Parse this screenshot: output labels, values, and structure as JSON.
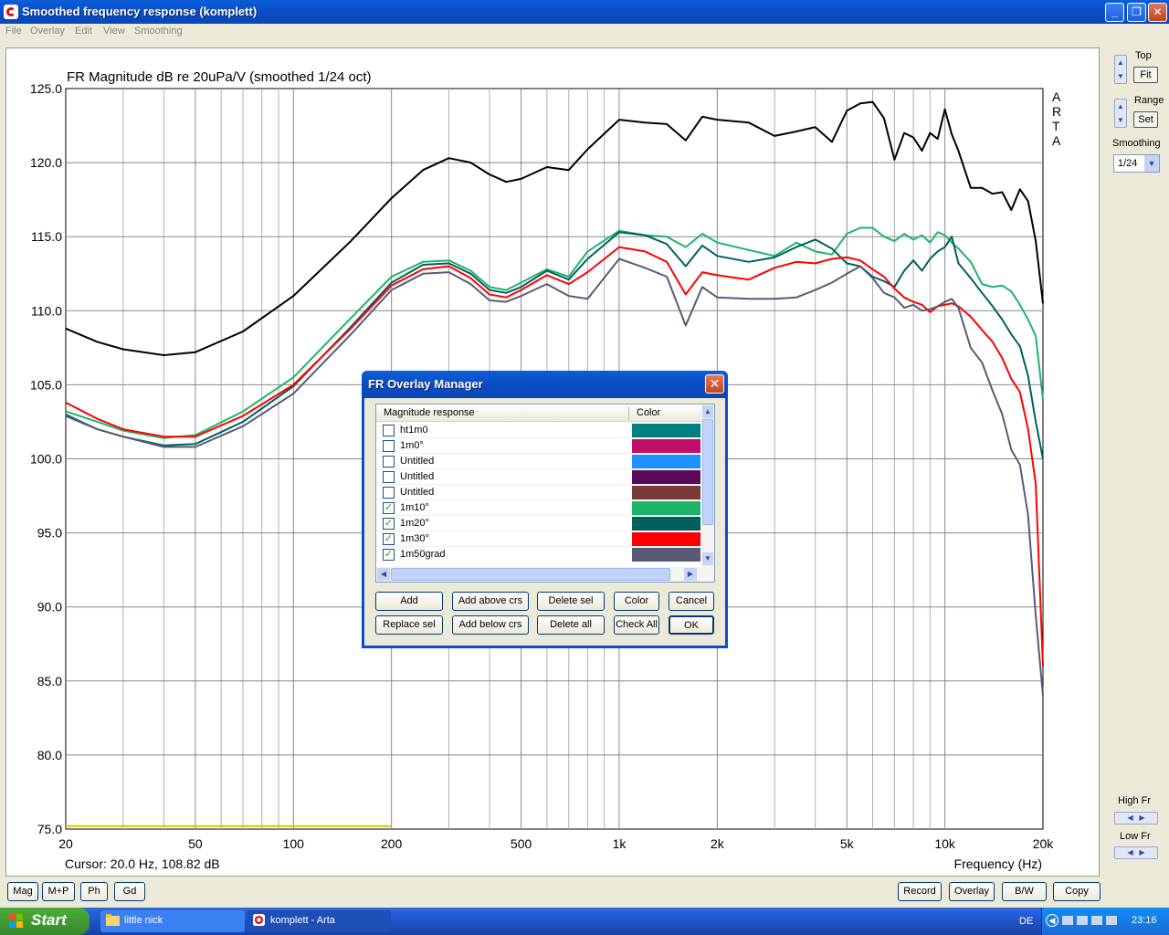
{
  "window": {
    "title": "Smoothed frequency response (komplett)"
  },
  "menu": [
    "File",
    "Overlay",
    "Edit",
    "View",
    "Smoothing"
  ],
  "plot": {
    "title": "FR Magnitude dB re 20uPa/V (smoothed 1/24 oct)",
    "watermark": [
      "A",
      "R",
      "T",
      "A"
    ],
    "cursor": "Cursor: 20.0 Hz, 108.82 dB",
    "xlabel": "Frequency (Hz)"
  },
  "side": {
    "top_label": "Top",
    "fit_label": "Fit",
    "range_label": "Range",
    "set_label": "Set",
    "smoothing_label": "Smoothing",
    "smoothing_value": "1/24",
    "highfr_label": "High Fr",
    "lowfr_label": "Low Fr"
  },
  "bottom_left": [
    "Mag",
    "M+P",
    "Ph",
    "Gd"
  ],
  "bottom_right": [
    "Record",
    "Overlay",
    "B/W",
    "Copy"
  ],
  "dialog": {
    "title": "FR Overlay Manager",
    "col_name": "Magnitude response",
    "col_color": "Color",
    "rows": [
      {
        "name": "ht1m0",
        "checked": false,
        "color": "#008080"
      },
      {
        "name": "1m0°",
        "checked": false,
        "color": "#c0106a"
      },
      {
        "name": "Untitled",
        "checked": false,
        "color": "#1e90ff"
      },
      {
        "name": "Untitled",
        "checked": false,
        "color": "#5a0a5a"
      },
      {
        "name": "Untitled",
        "checked": false,
        "color": "#7a3a3a"
      },
      {
        "name": "1m10°",
        "checked": true,
        "color": "#1db46a"
      },
      {
        "name": "1m20°",
        "checked": true,
        "color": "#006060"
      },
      {
        "name": "1m30°",
        "checked": true,
        "color": "#ff0000"
      },
      {
        "name": "1m50grad",
        "checked": true,
        "color": "#5a5a78"
      }
    ],
    "buttons_row1": [
      "Add",
      "Add above crs",
      "Delete sel",
      "Color",
      "Cancel"
    ],
    "buttons_row2": [
      "Replace sel",
      "Add below crs",
      "Delete all",
      "Check All",
      "OK"
    ]
  },
  "taskbar": {
    "start": "Start",
    "tasks": [
      "little nick",
      "komplett - Arta"
    ],
    "lang": "DE",
    "time": "23:16"
  },
  "chart_data": {
    "type": "line",
    "title": "FR Magnitude dB re 20uPa/V (smoothed 1/24 oct)",
    "xlabel": "Frequency (Hz)",
    "ylabel": "",
    "xscale": "log",
    "xlim": [
      20,
      20000
    ],
    "ylim": [
      75,
      125
    ],
    "xticks": [
      20,
      50,
      100,
      200,
      500,
      1000,
      2000,
      5000,
      10000,
      20000
    ],
    "xtick_labels": [
      "20",
      "50",
      "100",
      "200",
      "500",
      "1k",
      "2k",
      "5k",
      "10k",
      "20k"
    ],
    "yticks": [
      75,
      80,
      85,
      90,
      95,
      100,
      105,
      110,
      115,
      120,
      125
    ],
    "ytick_labels": [
      "75.0",
      "80.0",
      "85.0",
      "90.0",
      "95.0",
      "100.0",
      "105.0",
      "110.0",
      "115.0",
      "120.0",
      "125.0"
    ],
    "grid": true,
    "series": [
      {
        "color": "#000000",
        "x": [
          20,
          25,
          30,
          40,
          50,
          70,
          100,
          150,
          200,
          250,
          300,
          350,
          400,
          450,
          500,
          600,
          700,
          800,
          1000,
          1200,
          1400,
          1600,
          1800,
          2000,
          2500,
          3000,
          3500,
          4000,
          4500,
          5000,
          5500,
          6000,
          6500,
          7000,
          7500,
          8000,
          8500,
          9000,
          9500,
          10000,
          10500,
          11000,
          12000,
          13000,
          14000,
          15000,
          16000,
          17000,
          18000,
          19000,
          20000
        ],
        "y": [
          108.8,
          107.9,
          107.4,
          107.0,
          107.2,
          108.6,
          111.0,
          114.7,
          117.6,
          119.5,
          120.3,
          120.0,
          119.2,
          118.7,
          118.9,
          119.7,
          119.5,
          120.9,
          122.9,
          122.7,
          122.6,
          121.5,
          123.1,
          122.9,
          122.7,
          121.8,
          122.1,
          122.4,
          121.4,
          123.5,
          124.0,
          124.1,
          123.0,
          120.2,
          122.0,
          121.7,
          120.8,
          122.0,
          121.6,
          123.6,
          121.9,
          120.8,
          118.3,
          118.3,
          117.9,
          118.0,
          116.8,
          118.2,
          117.4,
          114.7,
          110.5
        ]
      },
      {
        "color": "#1db46a",
        "x": [
          20,
          25,
          30,
          40,
          50,
          70,
          100,
          150,
          200,
          250,
          300,
          350,
          400,
          450,
          500,
          600,
          700,
          800,
          1000,
          1200,
          1400,
          1600,
          1800,
          2000,
          2500,
          3000,
          3500,
          4000,
          4500,
          5000,
          5500,
          6000,
          6500,
          7000,
          7500,
          8000,
          8500,
          9000,
          9500,
          10000,
          10500,
          11000,
          12000,
          13000,
          14000,
          15000,
          16000,
          17000,
          18000,
          19000,
          20000
        ],
        "y": [
          103.2,
          102.5,
          101.9,
          101.4,
          101.6,
          103.2,
          105.5,
          109.5,
          112.3,
          113.3,
          113.4,
          112.7,
          111.6,
          111.4,
          111.9,
          112.8,
          112.3,
          114.0,
          115.4,
          115.1,
          115.0,
          114.3,
          115.2,
          114.6,
          114.1,
          113.7,
          114.6,
          114.0,
          113.8,
          115.2,
          115.6,
          115.6,
          115.0,
          114.7,
          115.2,
          114.8,
          115.1,
          114.6,
          115.3,
          115.1,
          114.6,
          114.2,
          113.3,
          111.8,
          111.6,
          111.7,
          111.3,
          110.4,
          109.4,
          108.3,
          104.0
        ]
      },
      {
        "color": "#006060",
        "x": [
          20,
          25,
          30,
          40,
          50,
          70,
          100,
          150,
          200,
          250,
          300,
          350,
          400,
          450,
          500,
          600,
          700,
          800,
          1000,
          1200,
          1400,
          1600,
          1800,
          2000,
          2500,
          3000,
          3500,
          4000,
          4500,
          5000,
          5500,
          6000,
          6500,
          7000,
          7500,
          8000,
          8500,
          9000,
          9500,
          10000,
          10500,
          11000,
          12000,
          13000,
          14000,
          15000,
          16000,
          17000,
          18000,
          19000,
          20000
        ],
        "y": [
          102.9,
          102.0,
          101.5,
          100.9,
          101.0,
          102.5,
          104.9,
          108.9,
          111.9,
          113.1,
          113.2,
          112.5,
          111.4,
          111.2,
          111.6,
          112.7,
          112.1,
          113.5,
          115.3,
          115.1,
          114.5,
          113.0,
          114.4,
          113.7,
          113.3,
          113.6,
          114.3,
          114.8,
          114.2,
          113.2,
          113.0,
          112.3,
          112.0,
          111.6,
          112.7,
          113.4,
          112.7,
          113.5,
          114.0,
          114.3,
          115.0,
          113.2,
          112.2,
          111.2,
          110.3,
          109.4,
          108.4,
          107.6,
          105.6,
          102.5,
          100.0
        ]
      },
      {
        "color": "#ff0000",
        "x": [
          20,
          25,
          30,
          40,
          50,
          70,
          100,
          150,
          200,
          250,
          300,
          350,
          400,
          450,
          500,
          600,
          700,
          800,
          1000,
          1200,
          1400,
          1600,
          1800,
          2000,
          2500,
          3000,
          3500,
          4000,
          4500,
          5000,
          5500,
          6000,
          6500,
          7000,
          7500,
          8000,
          8500,
          9000,
          9500,
          10000,
          10500,
          11000,
          12000,
          13000,
          14000,
          15000,
          16000,
          17000,
          18000,
          19000,
          20000
        ],
        "y": [
          103.8,
          102.7,
          102.0,
          101.5,
          101.5,
          102.9,
          105.0,
          108.8,
          111.7,
          112.8,
          113.0,
          112.2,
          111.1,
          110.9,
          111.4,
          112.4,
          111.8,
          112.6,
          114.3,
          114.0,
          113.3,
          111.1,
          112.6,
          112.4,
          112.1,
          112.9,
          113.3,
          113.2,
          113.5,
          113.6,
          113.4,
          112.8,
          112.3,
          111.5,
          110.9,
          110.6,
          110.4,
          109.9,
          110.3,
          110.4,
          110.5,
          110.3,
          109.6,
          108.7,
          107.9,
          106.8,
          105.4,
          104.5,
          102.0,
          98.3,
          86.0
        ]
      },
      {
        "color": "#5a5a78",
        "x": [
          20,
          25,
          30,
          40,
          50,
          70,
          100,
          150,
          200,
          250,
          300,
          350,
          400,
          450,
          500,
          600,
          700,
          800,
          1000,
          1200,
          1400,
          1600,
          1800,
          2000,
          2500,
          3000,
          3500,
          4000,
          4500,
          5000,
          5500,
          6000,
          6500,
          7000,
          7500,
          8000,
          8500,
          9000,
          9500,
          10000,
          10500,
          11000,
          12000,
          13000,
          14000,
          15000,
          16000,
          17000,
          18000,
          19000,
          20000
        ],
        "y": [
          103.0,
          102.0,
          101.5,
          100.8,
          100.8,
          102.2,
          104.4,
          108.4,
          111.4,
          112.5,
          112.6,
          111.8,
          110.7,
          110.6,
          111.0,
          111.8,
          111.0,
          110.8,
          113.5,
          112.9,
          112.3,
          109.0,
          111.6,
          110.9,
          110.8,
          110.8,
          110.9,
          111.4,
          111.9,
          112.5,
          113.0,
          112.2,
          111.2,
          110.9,
          110.2,
          110.4,
          110.0,
          110.1,
          110.3,
          110.6,
          110.8,
          110.2,
          107.5,
          106.5,
          104.6,
          103.0,
          100.6,
          99.6,
          96.2,
          89.4,
          84.0
        ]
      },
      {
        "color": "#d4c800",
        "x": [
          20,
          200
        ],
        "y": [
          75.2,
          75.2
        ]
      }
    ]
  }
}
